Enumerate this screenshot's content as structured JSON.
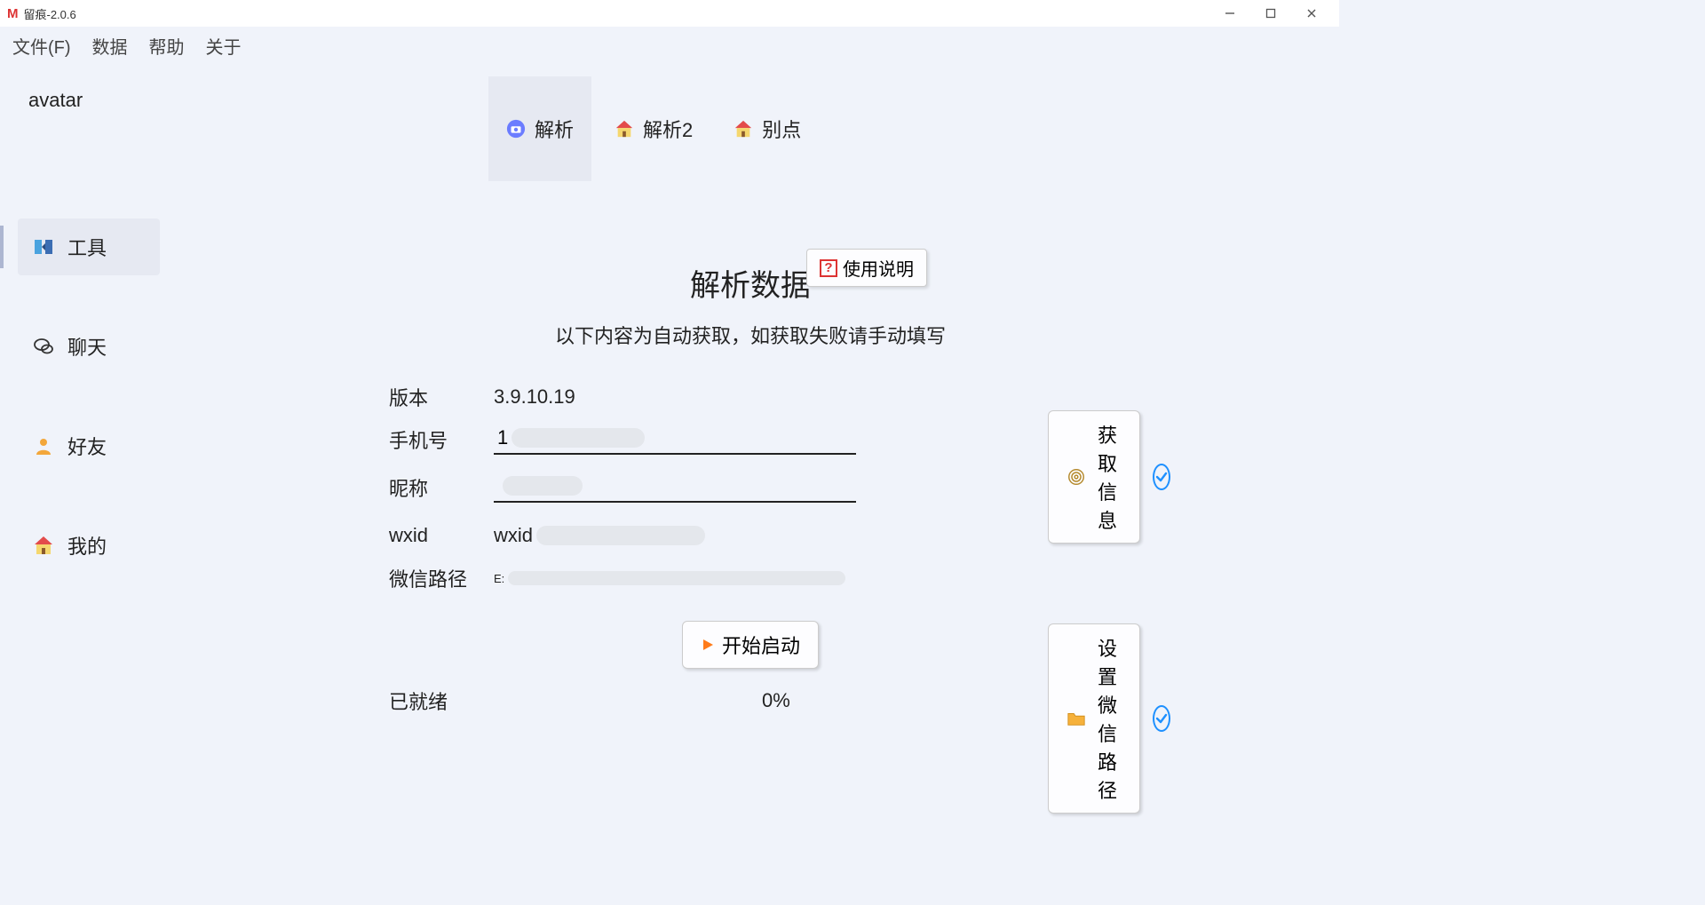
{
  "window": {
    "title": "留痕-2.0.6"
  },
  "menu": {
    "file": "文件(F)",
    "data": "数据",
    "help": "帮助",
    "about": "关于"
  },
  "sidebar": {
    "avatar_label": "avatar",
    "items": [
      {
        "label": "工具"
      },
      {
        "label": "聊天"
      },
      {
        "label": "好友"
      },
      {
        "label": "我的"
      }
    ]
  },
  "tabs": [
    {
      "label": "解析"
    },
    {
      "label": "解析2"
    },
    {
      "label": "别点"
    }
  ],
  "main": {
    "help_button": "使用说明",
    "heading": "解析数据",
    "subtitle": "以下内容为自动获取，如获取失败请手动填写",
    "fields": {
      "version_label": "版本",
      "version_value": "3.9.10.19",
      "phone_label": "手机号",
      "phone_value": "1",
      "nickname_label": "昵称",
      "nickname_value": "",
      "wxid_label": "wxid",
      "wxid_value": "wxid",
      "path_label": "微信路径",
      "path_value": "E:"
    },
    "buttons": {
      "get_info": "获取信息",
      "set_path": "设置微信路径",
      "start": "开始启动"
    },
    "status": {
      "label": "已就绪",
      "progress": "0%"
    }
  }
}
